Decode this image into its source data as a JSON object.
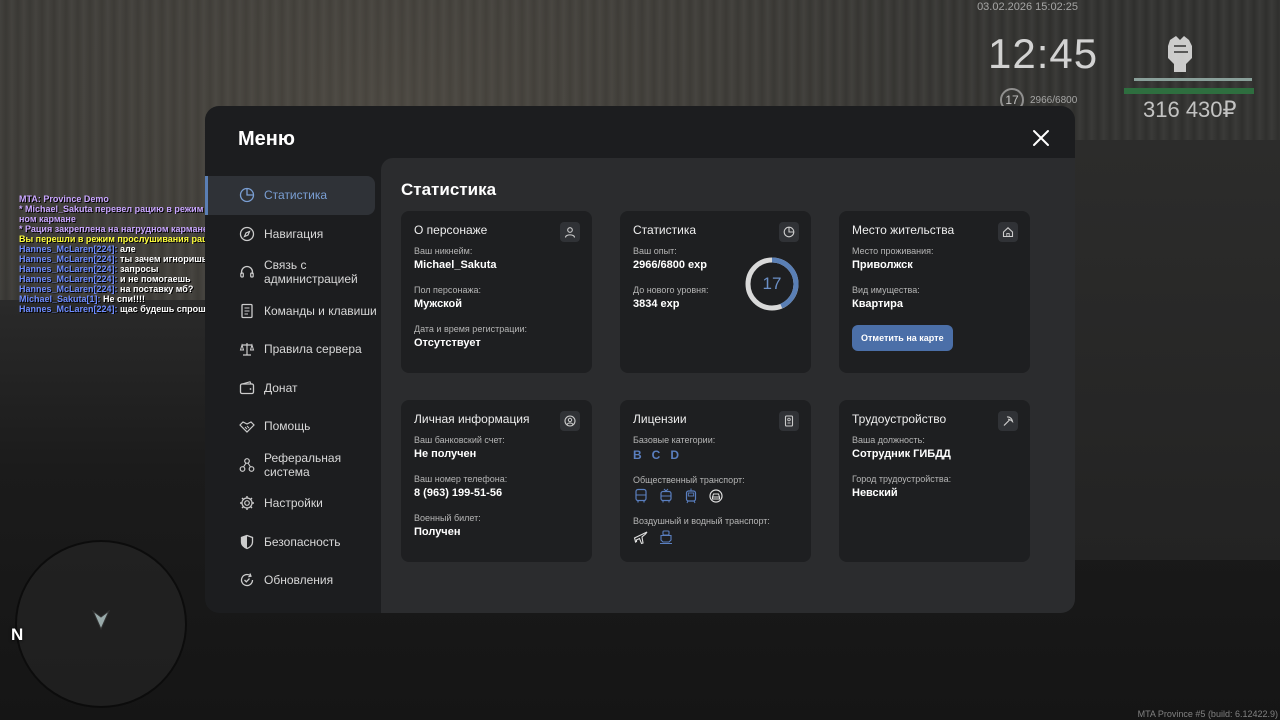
{
  "hud": {
    "datetime": "03.02.2026 15:02:25",
    "clock": "12:45",
    "level": "17",
    "exp": "2966/6800",
    "money": "316 430₽"
  },
  "chat": [
    {
      "text": "MTA: Province Demo",
      "color": "purple"
    },
    {
      "text": "* Michael_Sakuta перевел рацию в режим прослушивания и закрепил на нагруд",
      "color": "purple"
    },
    {
      "text": "ном кармане",
      "color": "purple"
    },
    {
      "text": "* Рация закреплена на нагрудном кармане. (Michael_Sakuta)",
      "color": "purple"
    },
    {
      "text": "Вы перешли в режим прослушивания рации.",
      "color": "yellow"
    },
    {
      "name": "Hannes_McLaren[224]:",
      "msg": "але"
    },
    {
      "name": "Hannes_McLaren[224]:",
      "msg": "ты зачем игноришь"
    },
    {
      "name": "Hannes_McLaren[224]:",
      "msg": "запросы"
    },
    {
      "name": "Hannes_McLaren[224]:",
      "msg": "и не помогаешь"
    },
    {
      "name": "Hannes_McLaren[224]:",
      "msg": "на поставку мб?"
    },
    {
      "name": "Michael_Sakuta[1]:",
      "msg": "Не спи!!!!"
    },
    {
      "name": "Hannes_McLaren[224]:",
      "msg": "щас будешь спрошен"
    }
  ],
  "minimap": {
    "north": "N"
  },
  "build": "MTA Province #5 (build: 6.12422.9)",
  "menu": {
    "title": "Меню",
    "nav": [
      {
        "id": "stats",
        "label": "Статистика",
        "icon": "pie-chart-icon",
        "active": true
      },
      {
        "id": "navigation",
        "label": "Навигация",
        "icon": "compass-icon"
      },
      {
        "id": "contact",
        "label": "Связь с администрацией",
        "icon": "headset-icon"
      },
      {
        "id": "commands",
        "label": "Команды и клавиши",
        "icon": "document-icon"
      },
      {
        "id": "rules",
        "label": "Правила сервера",
        "icon": "scales-icon"
      },
      {
        "id": "donate",
        "label": "Донат",
        "icon": "wallet-icon"
      },
      {
        "id": "help",
        "label": "Помощь",
        "icon": "handshake-icon"
      },
      {
        "id": "referral",
        "label": "Реферальная система",
        "icon": "network-icon"
      },
      {
        "id": "settings",
        "label": "Настройки",
        "icon": "gear-icon"
      },
      {
        "id": "security",
        "label": "Безопасность",
        "icon": "shield-icon"
      },
      {
        "id": "updates",
        "label": "Обновления",
        "icon": "refresh-check-icon"
      }
    ],
    "content_title": "Статистика",
    "character": {
      "title": "О персонаже",
      "nickname_label": "Ваш никнейм:",
      "nickname": "Michael_Sakuta",
      "gender_label": "Пол персонажа:",
      "gender": "Мужской",
      "reg_label": "Дата и время регистрации:",
      "reg": "Отсутствует"
    },
    "statistics": {
      "title": "Статистика",
      "exp_label": "Ваш опыт:",
      "exp": "2966/6800 exp",
      "next_label": "До нового уровня:",
      "next": "3834 exp",
      "level": "17",
      "progress": 0.436
    },
    "residence": {
      "title": "Место жительства",
      "place_label": "Место проживания:",
      "place": "Приволжск",
      "property_label": "Вид имущества:",
      "property": "Квартира",
      "map_button": "Отметить на карте"
    },
    "personal": {
      "title": "Личная информация",
      "bank_label": "Ваш банковский счет:",
      "bank": "Не получен",
      "phone_label": "Ваш номер телефона:",
      "phone": "8 (963) 199-51-56",
      "military_label": "Военный билет:",
      "military": "Получен"
    },
    "licenses": {
      "title": "Лицензии",
      "base_label": "Базовые категории:",
      "categories": [
        "B",
        "C",
        "D"
      ],
      "public_label": "Общественный транспорт:",
      "air_label": "Воздушный и водный транспорт:"
    },
    "employment": {
      "title": "Трудоустройство",
      "position_label": "Ваша должность:",
      "position": "Сотрудник ГИБДД",
      "city_label": "Город трудоустройства:",
      "city": "Невский"
    },
    "colors": {
      "accent": "#5a7fb5",
      "card": "#1e1f21",
      "panel": "#2b2c2e",
      "window": "#1c1d1f"
    }
  }
}
